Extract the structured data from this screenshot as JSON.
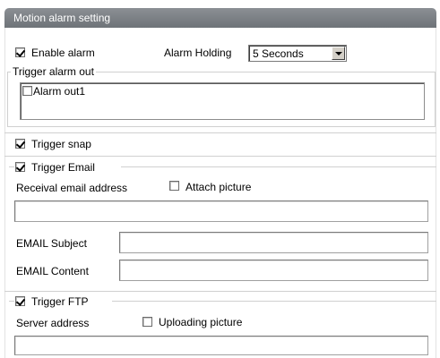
{
  "title": "Motion alarm setting",
  "enable_alarm": {
    "label": "Enable alarm",
    "checked": true
  },
  "alarm_holding": {
    "label": "Alarm Holding",
    "value": "5 Seconds"
  },
  "trigger_alarm_out": {
    "label": "Trigger alarm out",
    "items": [
      {
        "label": "Alarm out1",
        "checked": false
      }
    ]
  },
  "trigger_snap": {
    "label": "Trigger snap",
    "checked": true
  },
  "trigger_email": {
    "label": "Trigger Email",
    "checked": true,
    "receival_label": "Receival email address",
    "attach_label": "Attach picture",
    "attach_checked": false,
    "receival_value": "",
    "subject_label": "EMAIL Subject",
    "subject_value": "",
    "content_label": "EMAIL Content",
    "content_value": ""
  },
  "trigger_ftp": {
    "label": "Trigger FTP",
    "checked": true,
    "server_label": "Server address",
    "upload_label": "Uploading picture",
    "upload_checked": false,
    "server_value": ""
  },
  "icons": {
    "dropdown": "chevron-down-icon",
    "check": "checkmark-icon"
  }
}
